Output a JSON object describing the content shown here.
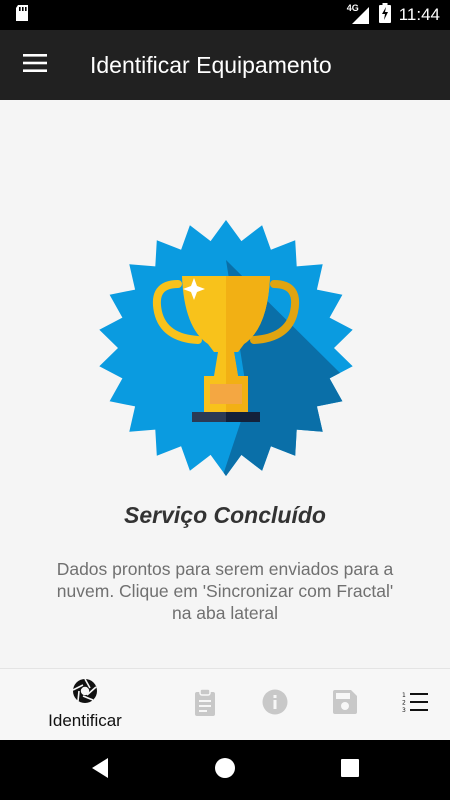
{
  "status_bar": {
    "network": "4G",
    "time": "11:44",
    "icons": [
      "sd-card-icon",
      "signal-icon",
      "battery-charging-icon"
    ]
  },
  "app_bar": {
    "title": "Identificar Equipamento",
    "menu_icon": "hamburger-menu-icon"
  },
  "main": {
    "badge_icon": "trophy-badge-icon",
    "title": "Serviço Concluído",
    "description": "Dados prontos para serem enviados para a nuvem. Clique em 'Sincronizar com Fractal' na aba lateral"
  },
  "bottom_nav": {
    "items": [
      {
        "label": "Identificar",
        "icon": "camera-shutter-icon",
        "active": true
      },
      {
        "label": "",
        "icon": "clipboard-icon",
        "active": false
      },
      {
        "label": "",
        "icon": "info-icon",
        "active": false
      },
      {
        "label": "",
        "icon": "save-icon",
        "active": false
      },
      {
        "label": "",
        "icon": "numbered-list-icon",
        "active": false
      }
    ]
  },
  "system_nav": {
    "icons": [
      "back-icon",
      "home-icon",
      "recents-icon"
    ]
  },
  "colors": {
    "app_bar": "#212121",
    "badge_blue": "#0a9be0",
    "badge_shadow": "#0a6fa8",
    "trophy_gold": "#f8c21b",
    "title_text": "#333333",
    "body_text": "#707070",
    "inactive_icon": "#c8c8c8"
  }
}
